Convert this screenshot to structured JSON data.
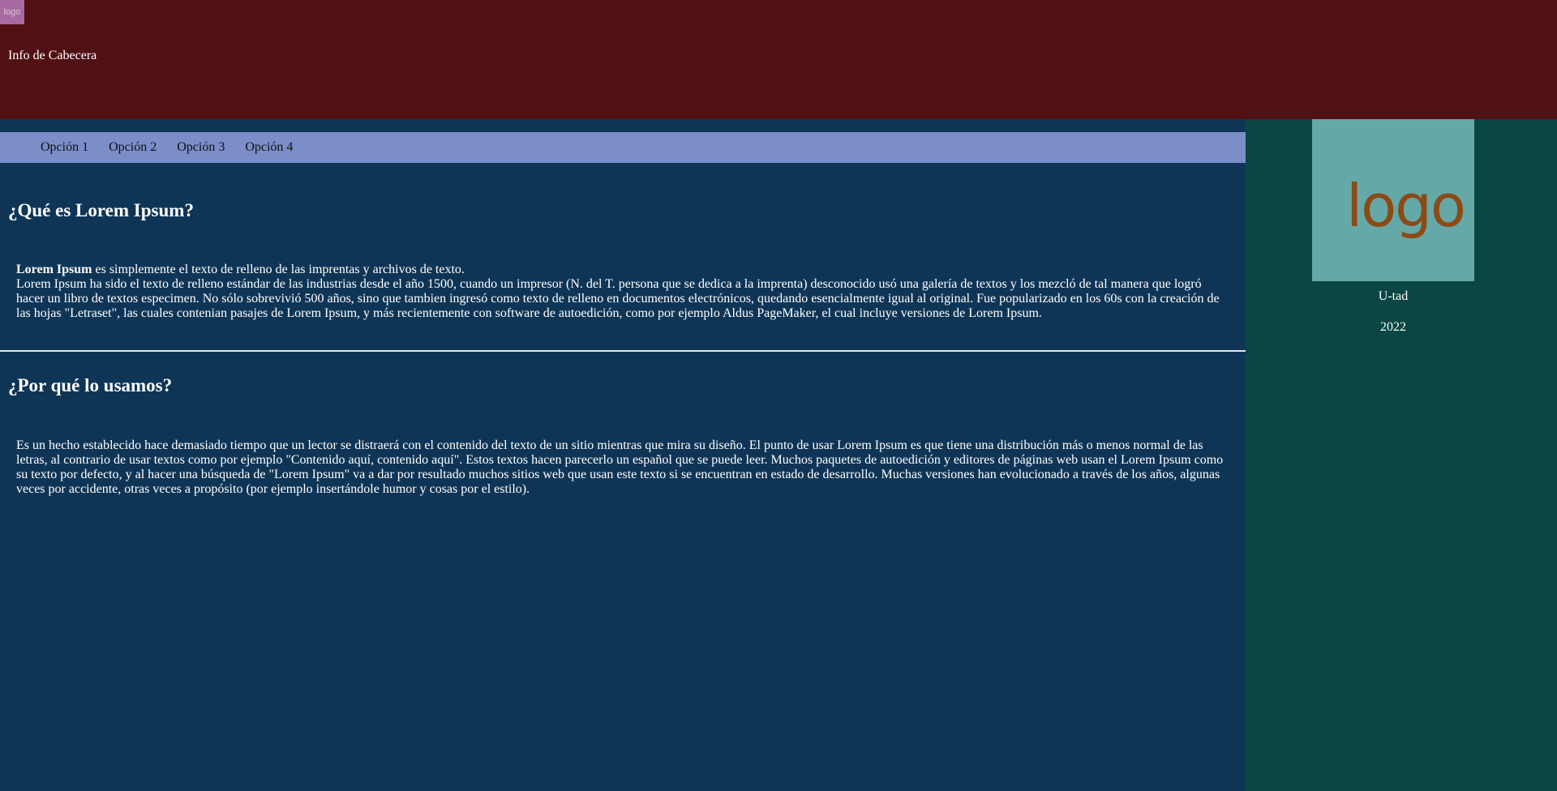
{
  "header": {
    "logo_text": "logo",
    "info": "Info de Cabecera"
  },
  "nav": {
    "items": [
      {
        "label": "Opción 1"
      },
      {
        "label": "Opción 2"
      },
      {
        "label": "Opción 3"
      },
      {
        "label": "Opción 4"
      }
    ]
  },
  "main": {
    "section1": {
      "title": "¿Qué es Lorem Ipsum?",
      "bold_lead": "Lorem Ipsum",
      "lead_rest": " es simplemente el texto de relleno de las imprentas y archivos de texto.",
      "body": "Lorem Ipsum ha sido el texto de relleno estándar de las industrias desde el año 1500, cuando un impresor (N. del T. persona que se dedica a la imprenta) desconocido usó una galería de textos y los mezcló de tal manera que logró hacer un libro de textos especimen. No sólo sobrevivió 500 años, sino que tambien ingresó como texto de relleno en documentos electrónicos, quedando esencialmente igual al original. Fue popularizado en los 60s con la creación de las hojas \"Letraset\", las cuales contenian pasajes de Lorem Ipsum, y más recientemente con software de autoedición, como por ejemplo Aldus PageMaker, el cual incluye versiones de Lorem Ipsum."
    },
    "section2": {
      "title": "¿Por qué lo usamos?",
      "body": "Es un hecho establecido hace demasiado tiempo que un lector se distraerá con el contenido del texto de un sitio mientras que mira su diseño. El punto de usar Lorem Ipsum es que tiene una distribución más o menos normal de las letras, al contrario de usar textos como por ejemplo \"Contenido aquí, contenido aquí\". Estos textos hacen parecerlo un español que se puede leer. Muchos paquetes de autoedición y editores de páginas web usan el Lorem Ipsum como su texto por defecto, y al hacer una búsqueda de \"Lorem Ipsum\" va a dar por resultado muchos sitios web que usan este texto si se encuentran en estado de desarrollo. Muchas versiones han evolucionado a través de los años, algunas veces por accidente, otras veces a propósito (por ejemplo insertándole humor y cosas por el estilo)."
    }
  },
  "sidebar": {
    "logo_text": "logo",
    "org": "U-tad",
    "year": "2022"
  },
  "colors": {
    "header_bg": "#511014",
    "main_bg": "#0f3556",
    "nav_bg": "#7b8ec8",
    "sidebar_bg": "#0a4643",
    "sidebar_logo_bg": "#64a8a8",
    "sidebar_logo_text": "#8c4a14",
    "header_logo_bg": "#a86aa0"
  }
}
